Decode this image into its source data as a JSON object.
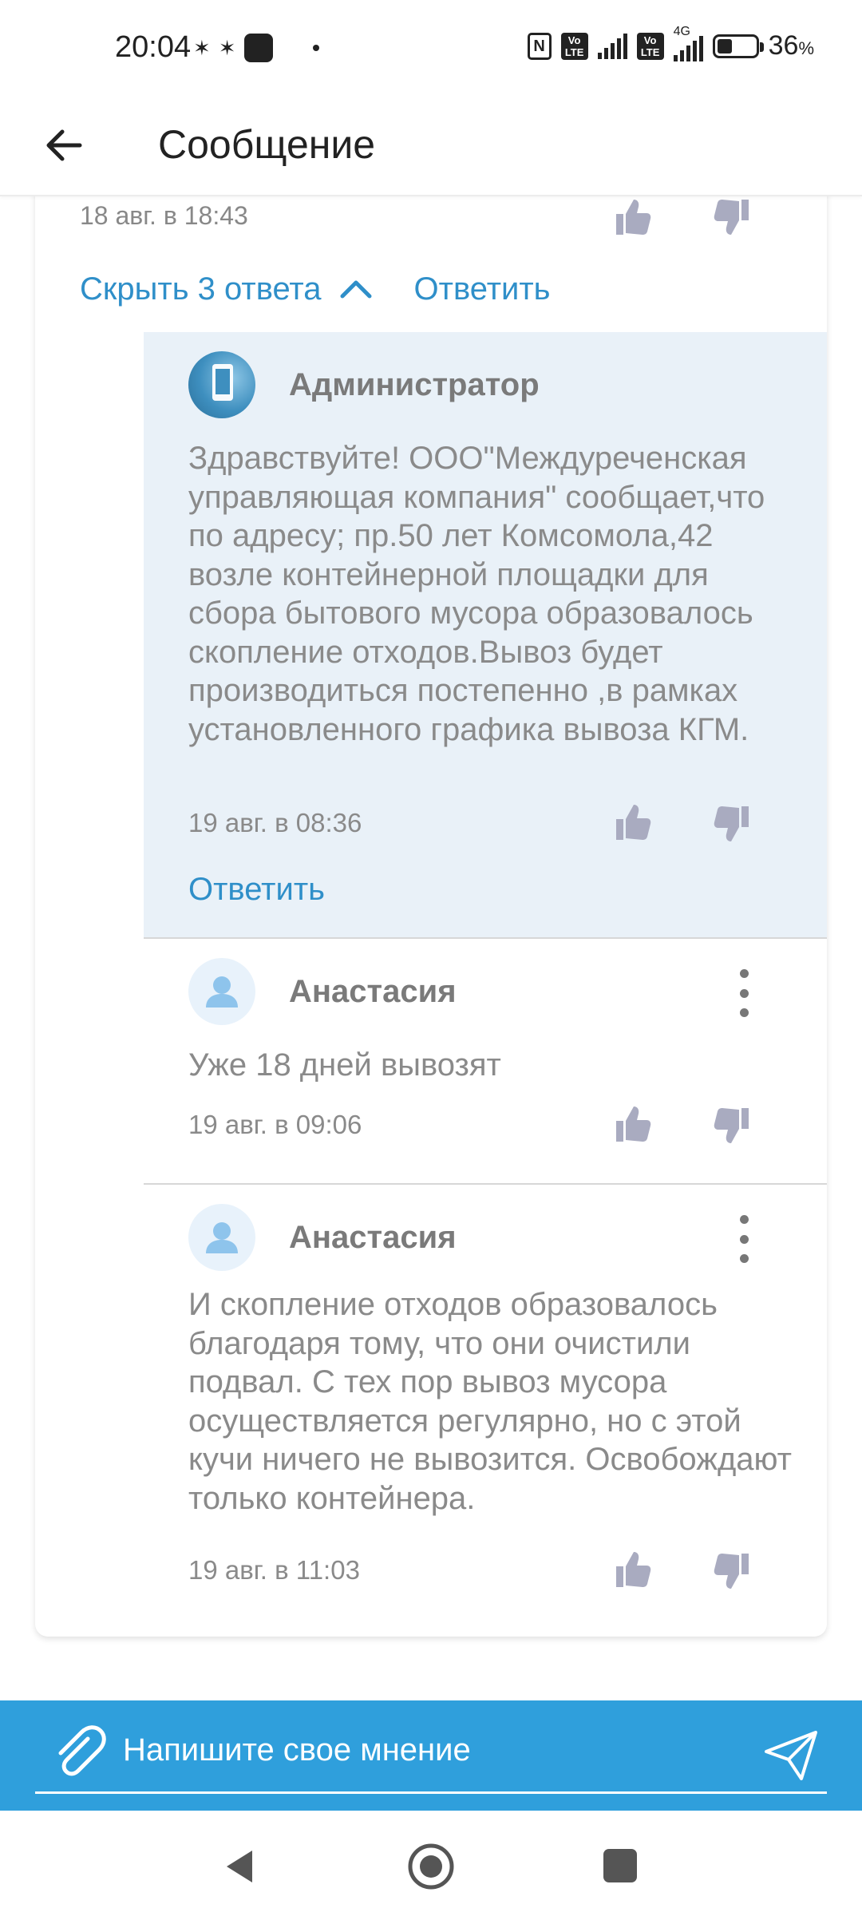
{
  "status_bar": {
    "time": "20:04",
    "battery_percent": "36",
    "battery_symbol": "%",
    "volte_label": "Vo LTE",
    "network_label": "4G",
    "nfc_label": "N"
  },
  "header": {
    "title": "Сообщение"
  },
  "thread": {
    "previous_comment_date": "18 авг. в 18:43",
    "hide_replies_label": "Скрыть 3 ответа",
    "reply_label": "Ответить",
    "replies": [
      {
        "author": "Администратор",
        "text": "Здравствуйте! ООО\"Междуреченская управляющая компания\" сообщает,что по адресу; пр.50 лет Комсомола,42 возле контейнерной площадки  для сбора бытового мусора образовалось скопление отходов.Вывоз будет производиться постепенно ,в рамках установленного графика вывоза КГМ.",
        "date": "19 авг. в 08:36",
        "reply_label": "Ответить"
      },
      {
        "author": "Анастасия",
        "text": "Уже 18 дней вывозят",
        "date": "19 авг. в 09:06"
      },
      {
        "author": "Анастасия",
        "text": "И скопление отходов образовалось благодаря тому, что они очистили подвал. С тех пор вывоз мусора осуществляется регулярно, но с этой кучи ничего не вывозится. Освобождают только контейнера.",
        "date": "19 авг. в 11:03"
      }
    ]
  },
  "composer": {
    "placeholder": "Напишите свое мнение"
  },
  "colors": {
    "accent": "#2f8fc9",
    "input_bar": "#2f9fdc",
    "admin_bg": "#e9f1f8",
    "thumb": "#a9abc0"
  }
}
